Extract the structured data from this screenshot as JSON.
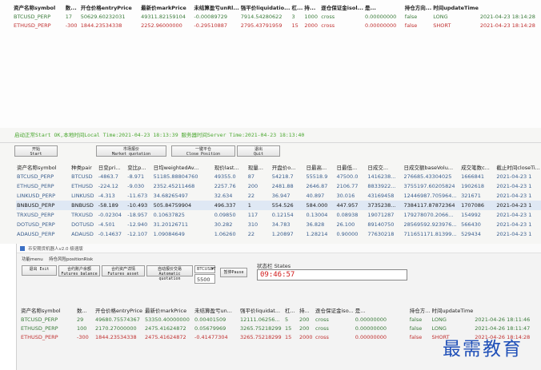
{
  "top_positions": {
    "columns": [
      "资产名称symbol",
      "数...",
      "开仓价格entryPrice",
      "最新价markPrice",
      "未结算盈亏unRl...",
      "强平价liquidatio...",
      "杠...",
      "持...",
      "逐仓保证金isol...",
      "是...",
      "持仓方向...",
      "时间updateTime"
    ],
    "rows": [
      [
        "BTCUSD_PERP",
        "17",
        "50629.60232031",
        "49311.82159104",
        "-0.00089729",
        "7914.54280622",
        "3",
        "1000",
        "cross",
        "0.00000000",
        "false",
        "LONG",
        "2021-04-23 18:14:28"
      ],
      [
        "ETHUSD_PERP",
        "-300",
        "1844.23534338",
        "2252.96000000",
        "-0.29510887",
        "2795.43791959",
        "15",
        "2000",
        "cross",
        "0.00000000",
        "false",
        "SHORT",
        "2021-04-23 18:14:28"
      ]
    ],
    "row_sides": [
      "long",
      "short"
    ]
  },
  "middle_window": {
    "status_line": "启动正常Start OK,本地时间Local Time:2021-04-23 18:13:39 服务器时间Server Time:2021-04-23 18:13:40",
    "buttons": [
      {
        "line1": "开始",
        "line2": "Start"
      },
      {
        "line1": "市场报价",
        "line2": "Market quotation"
      },
      {
        "line1": "一键平仓",
        "line2": "Close Position"
      },
      {
        "line1": "退出",
        "line2": "Quit"
      }
    ],
    "market_table": {
      "columns": [
        "资产名称symbol",
        "种类pair",
        "日变pri...",
        "变比p...",
        "日均weightedAv...",
        "现价last...",
        "现量...",
        "开盘价o...",
        "日最高...",
        "日最低...",
        "日成交...",
        "日成交额baseVolu...",
        "成交笔数c...",
        "截止时间closeTi..."
      ],
      "rows": [
        [
          "BTCUSD_PERP",
          "BTCUSD",
          "-4863.7",
          "-8.971",
          "51185.88804760",
          "49355.0",
          "87",
          "54218.7",
          "55518.9",
          "47500.0",
          "1416238...",
          "276685.43304025",
          "1666841",
          "2021-04-23 1"
        ],
        [
          "ETHUSD_PERP",
          "ETHUSD",
          "-224.12",
          "-9.030",
          "2352.45211468",
          "2257.76",
          "200",
          "2481.88",
          "2646.87",
          "2106.77",
          "8833922...",
          "3755197.60205824",
          "1902618",
          "2021-04-23 1"
        ],
        [
          "LINKUSD_PERP",
          "LINKUSD",
          "-4.313",
          "-11.673",
          "34.68265497",
          "32.634",
          "22",
          "36.947",
          "40.897",
          "30.016",
          "43169458",
          "12446987.705964...",
          "321671",
          "2021-04-23 1"
        ],
        [
          "BNBUSD_PERP",
          "BNBUSD",
          "-58.189",
          "-10.493",
          "505.84759904",
          "496.337",
          "1",
          "554.526",
          "584.000",
          "447.957",
          "3735238...",
          "7384117.87872364",
          "1707086",
          "2021-04-23 1"
        ],
        [
          "TRXUSD_PERP",
          "TRXUSD",
          "-0.02304",
          "-18.957",
          "0.10637825",
          "0.09850",
          "117",
          "0.12154",
          "0.13004",
          "0.08938",
          "19071287",
          "179278070.2066...",
          "154992",
          "2021-04-23 1"
        ],
        [
          "DOTUSD_PERP",
          "DOTUSD",
          "-4.501",
          "-12.940",
          "31.20126711",
          "30.282",
          "310",
          "34.783",
          "36.828",
          "26.100",
          "89140750",
          "28569592.923976...",
          "566430",
          "2021-04-23 1"
        ],
        [
          "ADAUSD_PERP",
          "ADAUSD",
          "-0.14637",
          "-12.107",
          "1.09084649",
          "1.06260",
          "22",
          "1.20897",
          "1.28214",
          "0.90000",
          "77630218",
          "711651171.81399...",
          "529434",
          "2021-04-23 1"
        ]
      ],
      "selected_row": 3
    }
  },
  "bottom_window": {
    "title": "币安期货机器人v2.0 极速版",
    "menu": [
      "功能menu",
      "持仓风险positionRisk"
    ],
    "buttons": [
      {
        "line1": "退出",
        "line2": "Exit"
      },
      {
        "line1": "合约账户余额",
        "line2": "Futures balance"
      },
      {
        "line1": "合约资产详情",
        "line2": "Futures asset"
      },
      {
        "line1": "自动报价交易",
        "line2": "Automatic quotation"
      },
      {
        "line1": "暂停Pause",
        "line2": ""
      }
    ],
    "symbol_select": "BTCUSDT",
    "quantity_value": "5500",
    "status_label": "状态栏 States",
    "time_value": "09:46:57",
    "positions_table": {
      "columns": [
        "资产名称symbol",
        "数...",
        "开仓价格entryPrice",
        "最新价markPrice",
        "未结算盈亏un...",
        "强平价liquidat...",
        "杠...",
        "持...",
        "逐仓保证金iso...",
        "是...",
        "持仓方...",
        "时间updateTime"
      ],
      "rows": [
        [
          "BTCUSD_PERP",
          "29",
          "49680.75574367",
          "53350.40000000",
          "0.00401509",
          "12111.06256...",
          "5",
          "200",
          "cross",
          "0.00000000",
          "false",
          "LONG",
          "2021-04-26 18:11:46"
        ],
        [
          "ETHUSD_PERP",
          "100",
          "2170.27000000",
          "2475.41624872",
          "0.05679969",
          "3265.75218299",
          "15",
          "200",
          "cross",
          "0.00000000",
          "false",
          "LONG",
          "2021-04-26 18:11:47"
        ],
        [
          "ETHUSD_PERP",
          "-300",
          "1844.23534338",
          "2475.41624872",
          "-0.41477304",
          "3265.75218299",
          "15",
          "2000",
          "cross",
          "0.00000000",
          "false",
          "SHORT",
          "2021-04-26 18:14:28"
        ]
      ],
      "row_sides": [
        "long",
        "long",
        "short"
      ]
    }
  },
  "watermark": "最需教育",
  "colors": {
    "long": "#3a7b3a",
    "short": "#c03030",
    "status_ok": "#4aa72f",
    "time_red": "#d01818",
    "watermark": "#2050b8"
  }
}
